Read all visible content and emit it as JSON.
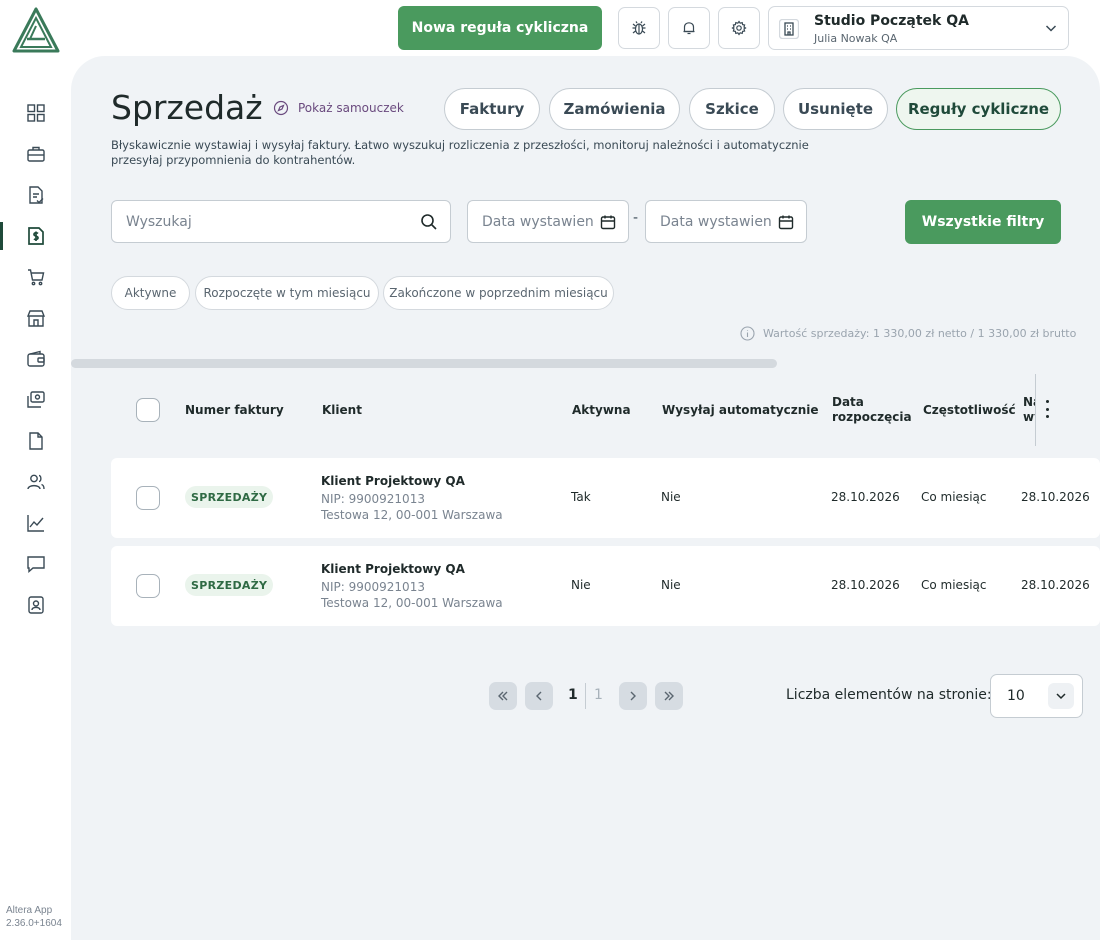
{
  "app": {
    "version_line1": "Altera App",
    "version_line2": "2.36.0+1604"
  },
  "topbar": {
    "new_rule_button": "Nowa reguła cykliczna",
    "company_name": "Studio Początek QA",
    "user_name": "Julia Nowak QA"
  },
  "sidebar": {
    "items": [
      {
        "icon": "dashboard-icon",
        "active": false
      },
      {
        "icon": "briefcase-icon",
        "active": false
      },
      {
        "icon": "document-check-icon",
        "active": false
      },
      {
        "icon": "sales-invoice-icon",
        "active": true
      },
      {
        "icon": "cart-icon",
        "active": false
      },
      {
        "icon": "store-icon",
        "active": false
      },
      {
        "icon": "wallet-icon",
        "active": false
      },
      {
        "icon": "money-transfer-icon",
        "active": false
      },
      {
        "icon": "file-icon",
        "active": false
      },
      {
        "icon": "users-icon",
        "active": false
      },
      {
        "icon": "chart-line-icon",
        "active": false
      },
      {
        "icon": "chat-icon",
        "active": false
      },
      {
        "icon": "contact-card-icon",
        "active": false
      }
    ]
  },
  "page": {
    "title": "Sprzedaż",
    "tutorial_link": "Pokaż samouczek",
    "subtitle": "Błyskawicznie wystawiaj i wysyłaj faktury. Łatwo wyszukuj rozliczenia z przeszłości, monitoruj należności i automatycznie przesyłaj przypomnienia do kontrahentów."
  },
  "tabs": [
    {
      "label": "Faktury",
      "active": false
    },
    {
      "label": "Zamówienia",
      "active": false
    },
    {
      "label": "Szkice",
      "active": false
    },
    {
      "label": "Usunięte",
      "active": false
    },
    {
      "label": "Reguły cykliczne",
      "active": true
    }
  ],
  "filters": {
    "search_placeholder": "Wyszukaj",
    "date_from_placeholder": "Data wystawienia",
    "date_to_placeholder": "Data wystawienia",
    "date_separator": "-",
    "all_filters_button": "Wszystkie filtry",
    "chips": [
      "Aktywne",
      "Rozpoczęte w tym miesiącu",
      "Zakończone w poprzednim miesiącu"
    ]
  },
  "summary": {
    "sales_value": "Wartość sprzedaży: 1 330,00 zł netto / 1 330,00 zł brutto"
  },
  "table": {
    "columns": {
      "invoice_number": "Numer faktury",
      "client": "Klient",
      "active": "Aktywna",
      "auto_send": "Wysyłaj automatycznie",
      "start_date_1": "Data",
      "start_date_2": "rozpoczęcia",
      "frequency": "Częstotliwość",
      "next_issue_1": "Najbliższe",
      "next_issue_2": "wystawienie"
    },
    "rows": [
      {
        "invoice_badge": "SPRZEDAŻY",
        "client_name": "Klient Projektowy QA",
        "client_nip": "NIP: 9900921013",
        "client_address": "Testowa 12, 00-001 Warszawa",
        "active": "Tak",
        "auto_send": "Nie",
        "start_date": "28.10.2026",
        "frequency": "Co miesiąc",
        "next_issue": "28.10.2026"
      },
      {
        "invoice_badge": "SPRZEDAŻY",
        "client_name": "Klient Projektowy QA",
        "client_nip": "NIP: 9900921013",
        "client_address": "Testowa 12, 00-001 Warszawa",
        "active": "Nie",
        "auto_send": "Nie",
        "start_date": "28.10.2026",
        "frequency": "Co miesiąc",
        "next_issue": "28.10.2026"
      }
    ]
  },
  "pagination": {
    "current_page": "1",
    "total_pages": "1",
    "per_page_label": "Liczba elementów na stronie:",
    "per_page_value": "10"
  },
  "colors": {
    "accent": "#4a9a5e",
    "panel_bg": "#f0f3f6",
    "dark_green": "#1f4a3a"
  }
}
